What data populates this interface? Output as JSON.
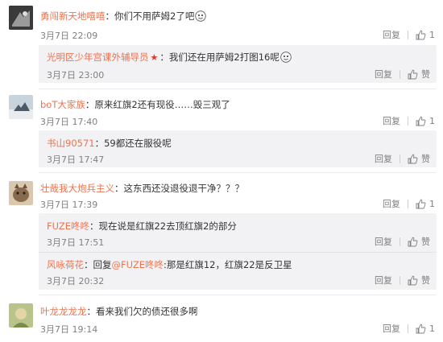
{
  "comments": [
    {
      "user": "勇闯新天地嘻嘻",
      "text": "：你们不用萨姆2了吧",
      "time": "3月7日 22:09",
      "reply": "回复",
      "like": "1",
      "replies": [
        {
          "user": "光明区少年宫课外辅导员",
          "text": "：我们还在用萨姆2打图16呢",
          "time": "3月7日 23:00",
          "reply": "回复",
          "like": "赞"
        }
      ]
    },
    {
      "user": "boT大家族",
      "text": "：原来红旗2还有现役……毁三观了",
      "time": "3月7日 17:40",
      "reply": "回复",
      "like": "1",
      "replies": [
        {
          "user": "书山90571",
          "text": "：59都还在服役呢",
          "time": "3月7日 17:47",
          "reply": "回复",
          "like": "赞"
        }
      ]
    },
    {
      "user": "壮哉我大炮兵主义",
      "text": "：这东西还没退役退干净？？？",
      "time": "3月7日 17:39",
      "reply": "回复",
      "like": "1",
      "replies": [
        {
          "user": "FUZE咚咚",
          "text": "：现在说是红旗22去顶红旗2的部分",
          "time": "3月7日 17:51",
          "reply": "回复",
          "like": "赞"
        },
        {
          "user": "风咏荷花",
          "text_prefix": "：回复",
          "mention": "@FUZE咚咚",
          "text": ":那是红旗12，红旗22是反卫星",
          "time": "3月7日 20:32",
          "reply": "回复",
          "like": "赞"
        }
      ]
    },
    {
      "user": "叶龙龙龙龙",
      "text": "：看来我们欠的债还很多啊",
      "time": "3月7日 19:14",
      "reply": "回复",
      "like": "1",
      "replies": []
    }
  ]
}
